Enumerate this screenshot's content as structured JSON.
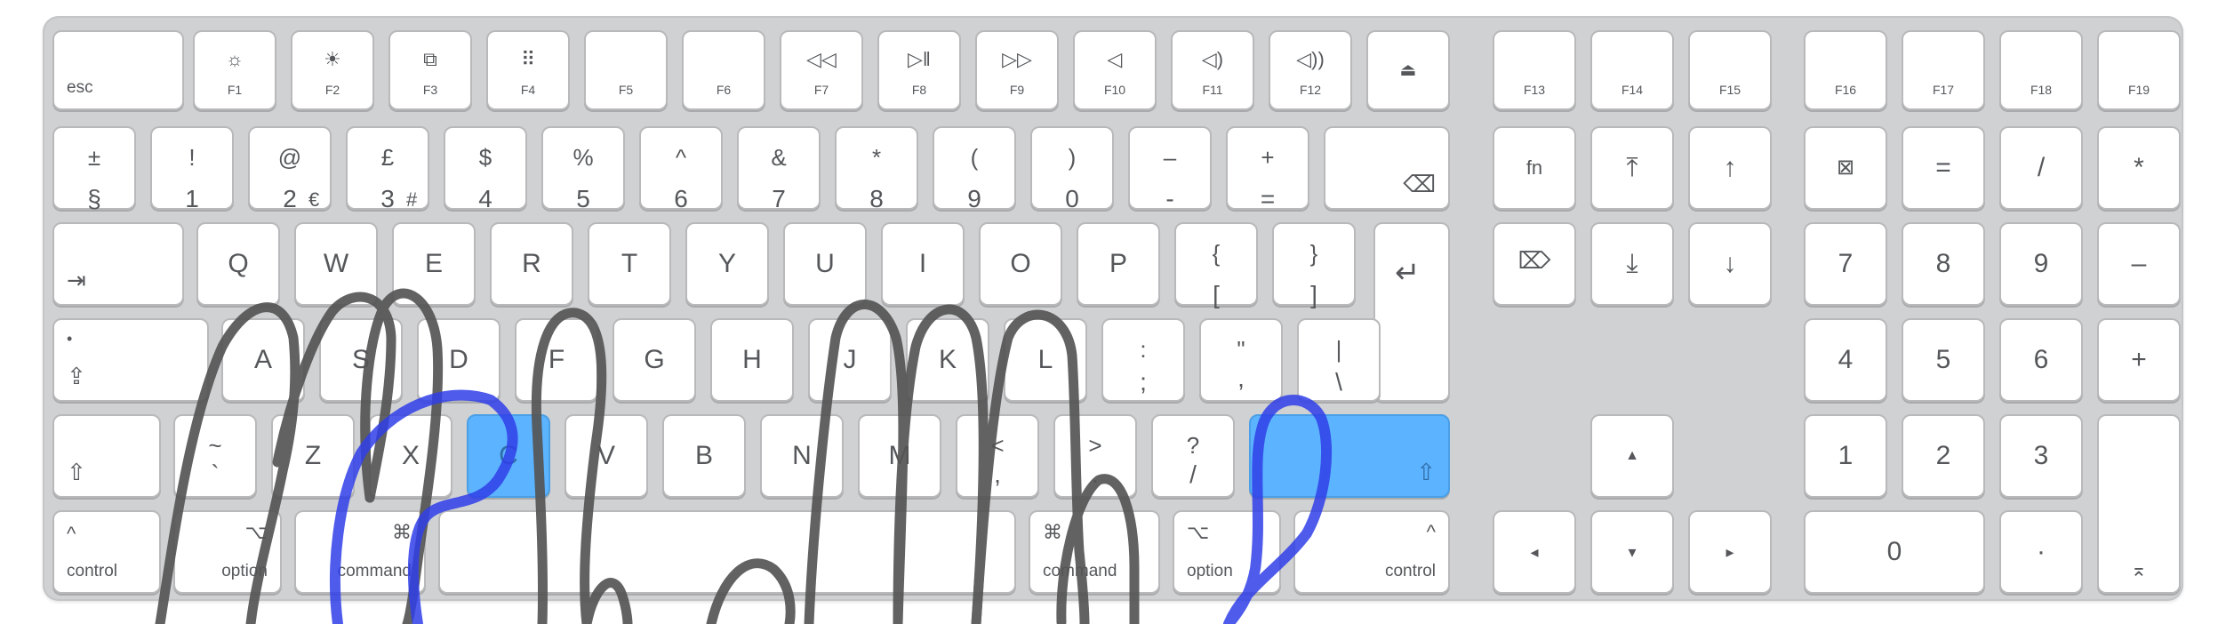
{
  "image": {
    "keyboard_color": "#d0d1d3",
    "key_color": "#ffffff",
    "highlight_color": "#5cb3ff",
    "finger_stroke_color": "#555555",
    "thumb_stroke_color": "#2f3ee8"
  },
  "keys": {
    "esc": "esc",
    "f1": "F1",
    "f1_icon": "☼",
    "f2": "F2",
    "f2_icon": "☀",
    "f3": "F3",
    "f3_icon": "⧉",
    "f4": "F4",
    "f4_icon": "⠿",
    "f5": "F5",
    "f6": "F6",
    "f7": "F7",
    "f7_icon": "◁◁",
    "f8": "F8",
    "f8_icon": "▷‖",
    "f9": "F9",
    "f9_icon": "▷▷",
    "f10": "F10",
    "f10_icon": "◁",
    "f11": "F11",
    "f11_icon": "◁)",
    "f12": "F12",
    "f12_icon": "◁))",
    "eject_icon": "⏏",
    "f13": "F13",
    "f14": "F14",
    "f15": "F15",
    "f16": "F16",
    "f17": "F17",
    "f18": "F18",
    "f19": "F19",
    "section_up": "±",
    "section_dn": "§",
    "d1_up": "!",
    "d1": "1",
    "d2_up": "@",
    "d2": "2",
    "d2_alt": "€",
    "d3_up": "£",
    "d3": "3",
    "d3_alt": "#",
    "d4_up": "$",
    "d4": "4",
    "d5_up": "%",
    "d5": "5",
    "d6_up": "^",
    "d6": "6",
    "d7_up": "&",
    "d7": "7",
    "d8_up": "*",
    "d8": "8",
    "d9_up": "(",
    "d9": "9",
    "d0_up": ")",
    "d0": "0",
    "minus_up": "–",
    "minus_dn": "-",
    "plus_up": "+",
    "plus_dn": "=",
    "delete_icon": "⌫",
    "fn": "fn",
    "home_icon": "⤒",
    "pgup_icon": "↑",
    "clear_icon": "⊠",
    "np_equals": "=",
    "np_slash": "/",
    "np_star": "*",
    "tab_icon": "⇥",
    "q": "Q",
    "w": "W",
    "e": "E",
    "r": "R",
    "t": "T",
    "y": "Y",
    "u": "U",
    "i": "I",
    "o": "O",
    "p": "P",
    "lbrace_up": "{",
    "lbrace_dn": "[",
    "rbrace_up": "}",
    "rbrace_dn": "]",
    "return_icon": "↵",
    "fwd_delete_icon": "⌦",
    "end_icon": "⤓",
    "pgdn_icon": "↓",
    "np7": "7",
    "np8": "8",
    "np9": "9",
    "np_minus": "–",
    "caps_dot": "•",
    "caps_icon": "⇪",
    "a": "A",
    "s": "S",
    "d": "D",
    "f": "F",
    "g": "G",
    "h": "H",
    "j": "J",
    "k": "K",
    "l": "L",
    "semi_up": ":",
    "semi_dn": ";",
    "quote_up": "\"",
    "quote_dn": ",",
    "pipe_up": "|",
    "pipe_dn": "\\",
    "np4": "4",
    "np5": "5",
    "np6": "6",
    "np_plus": "+",
    "lshift_icon": "⇧",
    "tilde_up": "~",
    "tilde_dn": "`",
    "z": "Z",
    "x": "X",
    "c": "C",
    "v": "V",
    "b": "B",
    "n": "N",
    "m": "M",
    "lt_up": "<",
    "lt_dn": ",",
    "gt_up": ">",
    "gt_dn": ".",
    "q_up": "?",
    "q_dn": "/",
    "rshift_icon": "⇧",
    "up_arrow": "▲",
    "np1": "1",
    "np2": "2",
    "np3": "3",
    "control_icon": "^",
    "control": "control",
    "option_icon": "⌥",
    "option": "option",
    "cmd_icon": "⌘",
    "command": "command",
    "left_arrow": "◂",
    "down_arrow": "▾",
    "right_arrow": "▸",
    "np0": "0",
    "np_dot": "·",
    "np_enter_icon": "⌅"
  }
}
